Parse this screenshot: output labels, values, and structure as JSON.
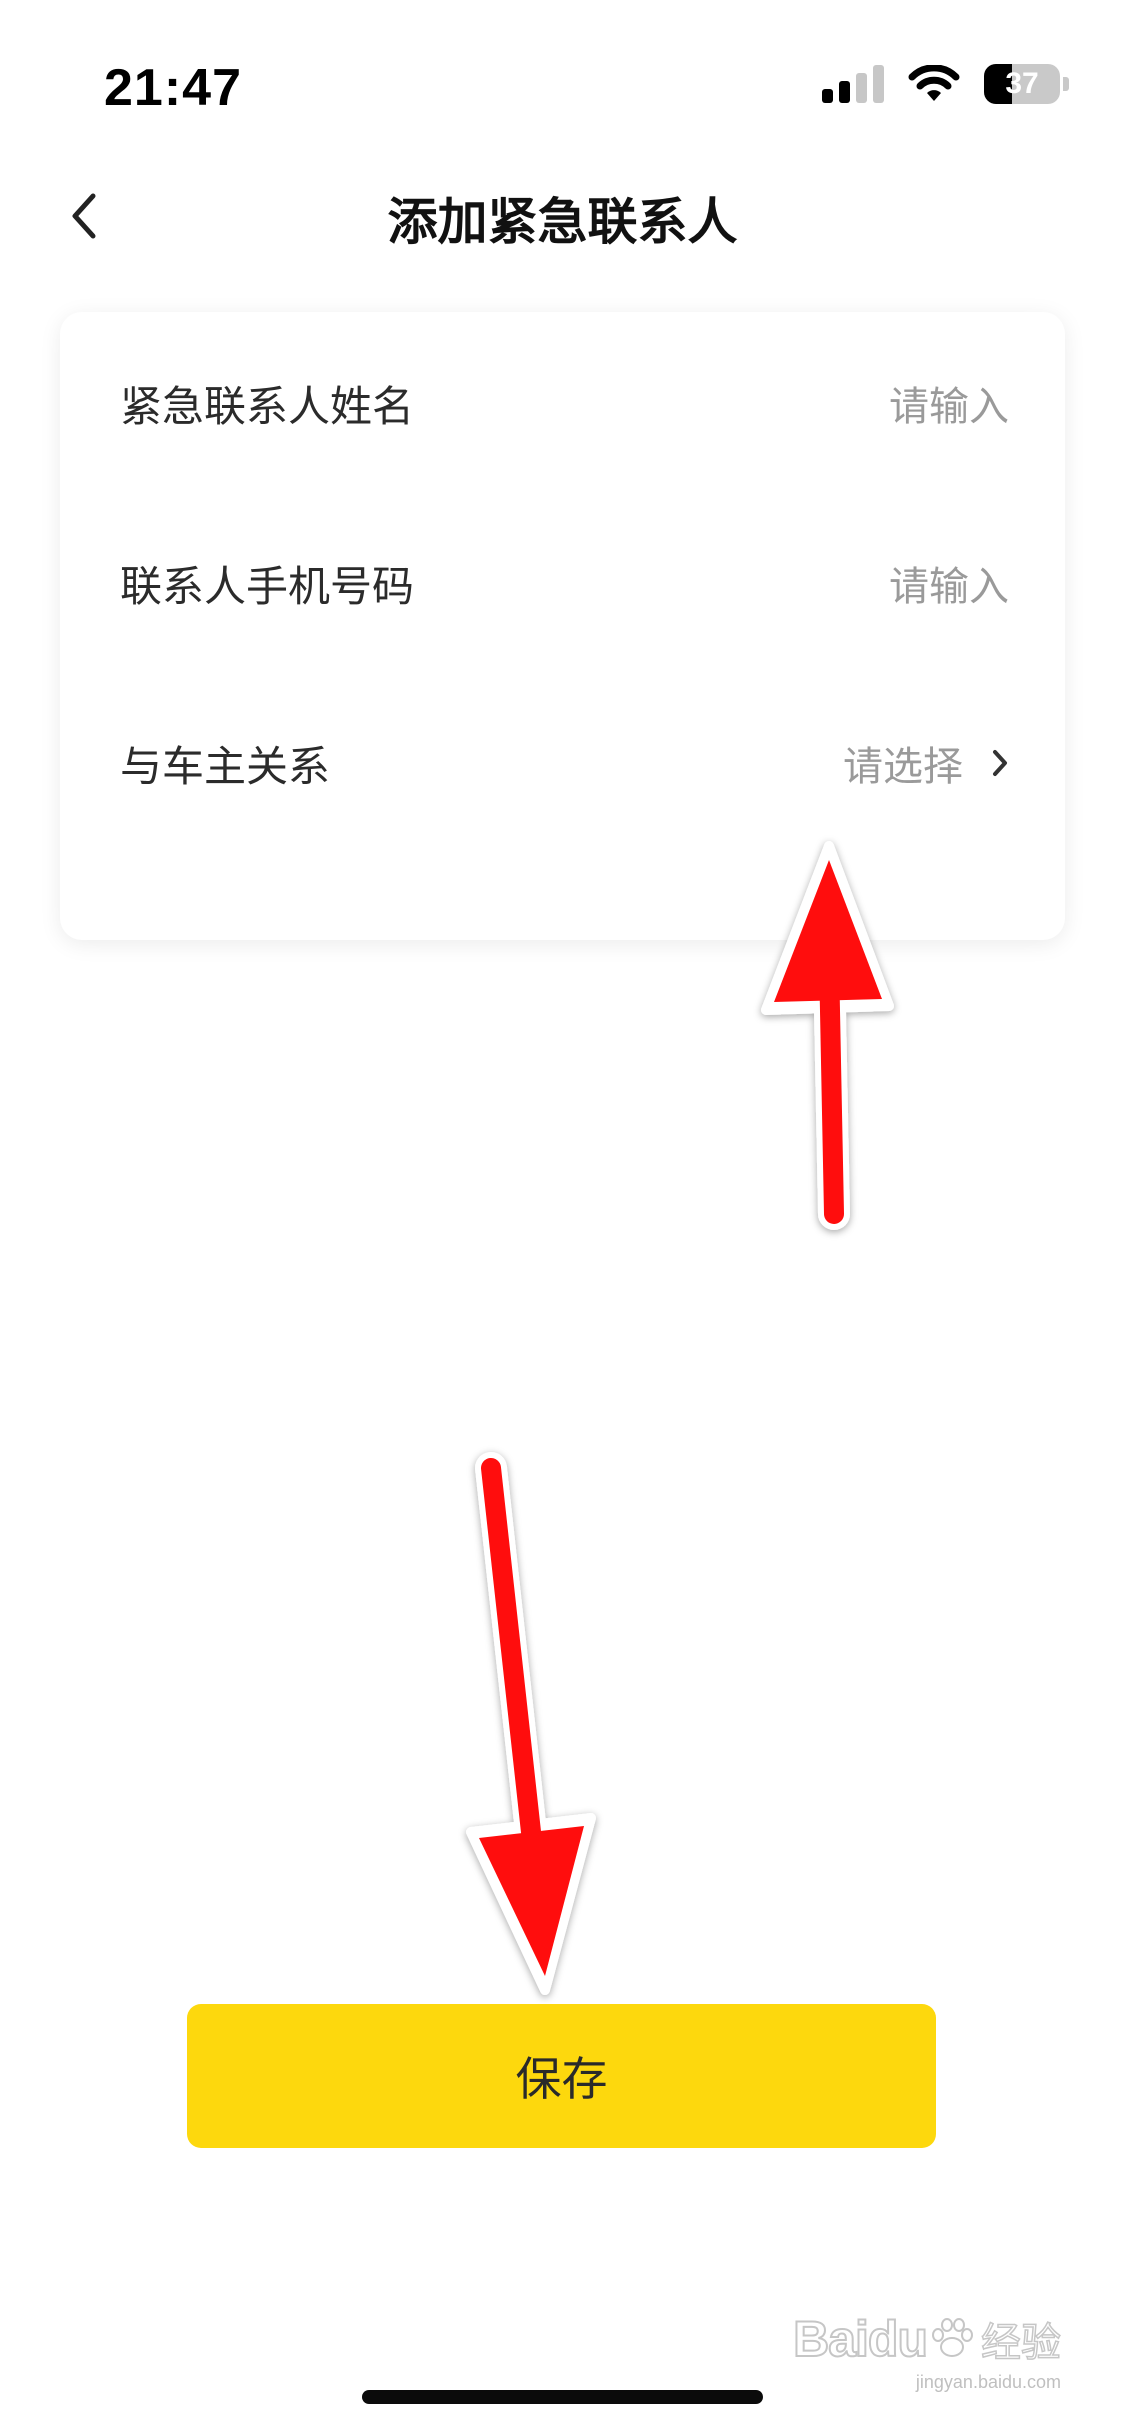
{
  "status_bar": {
    "time": "21:47",
    "battery_percent": "37",
    "battery_level": 0.37,
    "signal_bars_active": 2,
    "signal_bars_total": 4
  },
  "nav": {
    "title": "添加紧急联系人",
    "back_icon": "chevron-left-icon"
  },
  "form": {
    "rows": [
      {
        "label": "紧急联系人姓名",
        "placeholder": "请输入"
      },
      {
        "label": "联系人手机号码",
        "placeholder": "请输入"
      },
      {
        "label": "与车主关系",
        "placeholder": "请选择",
        "icon": "chevron-right-icon"
      }
    ]
  },
  "annotations": {
    "arrow_color": "#ff0a0a",
    "arrow_up_target": "relationship-row",
    "arrow_down_target": "save-button"
  },
  "actions": {
    "save_label": "保存",
    "save_color": "#fdd80d"
  },
  "watermark": {
    "brand": "Baidu",
    "cn": "经验",
    "url": "jingyan.baidu.com"
  }
}
